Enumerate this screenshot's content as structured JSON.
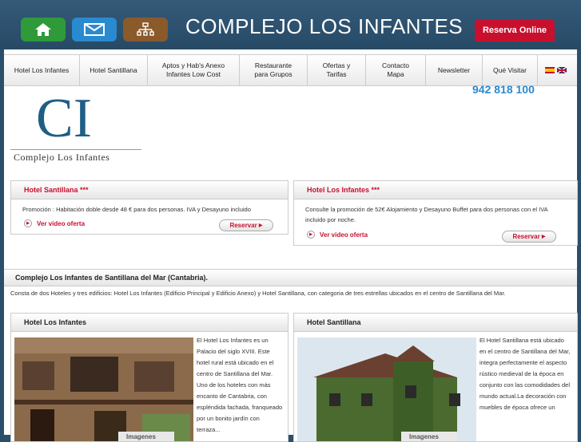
{
  "header": {
    "title": "COMPLEJO LOS INFANTES",
    "reserva_label": "Reserva Online",
    "icons": [
      "home-icon",
      "mail-icon",
      "sitemap-icon"
    ]
  },
  "nav": {
    "items": [
      {
        "label": "Hotel Los Infantes"
      },
      {
        "label": "Hotel Santillana"
      },
      {
        "label": "Aptos y Hab's Anexo\nInfantes Low Cost"
      },
      {
        "label": "Restaurante\npara Grupos"
      },
      {
        "label": "Ofertas y\nTarifas"
      },
      {
        "label": "Contacto\nMapa"
      },
      {
        "label": "Newsletter"
      },
      {
        "label": "Qué Visitar"
      }
    ]
  },
  "phone": "942 818 100",
  "logo": {
    "initials": "CI",
    "name": "Complejo Los Infantes"
  },
  "promos": [
    {
      "title": "Hotel Santillana ***",
      "text": "Promoción : Habitación doble desde 48 € para dos personas. IVA y Desayuno incluido",
      "video_label": "Ver video oferta",
      "button_label": "Reservar"
    },
    {
      "title": "Hotel Los Infantes ***",
      "text": "Consulte la promoción de 52€ Alojamiento y Desayuno Buffet para dos personas con el IVA incluido por noche.",
      "video_label": "Ver video oferta",
      "button_label": "Reservar"
    }
  ],
  "main": {
    "heading": "Complejo Los Infantes de Santillana del Mar (Cantabria).",
    "description": "Consta de dos Hoteles y tres edificios: Hotel Los Infantes (Edificio Principal y Edificio Anexo) y Hotel Santillana, con categoria de tres estrellas ubicados en el centro de Santillana del Mar."
  },
  "hotels": [
    {
      "title": "Hotel Los Infantes",
      "text": "El Hotel Los Infantes es un Palacio del siglo XVIII. Este hotel rural está ubicado en el centro de Santillana del Mar. Uno de los hoteles con más encanto de Cantabria, con espléndida fachada, franqueado por un bonito jardín con terraza...",
      "image_caption": "Imagenes"
    },
    {
      "title": "Hotel Santillana",
      "text": "El Hotel Santillana está ubicado en el centro de Santillana del Mar, integra perfectamente el aspecto rústico medieval de la época en conjunto con las comodidades del mundo actual.La decoración con muebles de época ofrece un",
      "image_caption": "Imagenes"
    }
  ]
}
